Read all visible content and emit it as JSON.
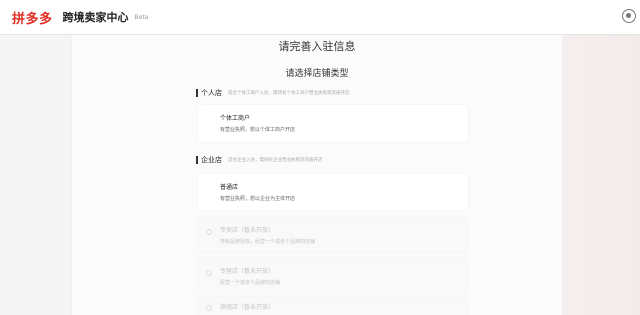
{
  "header": {
    "logo": "拼多多",
    "brand": "跨境卖家中心",
    "beta": "Beta",
    "user_icon": "user-icon"
  },
  "page": {
    "title": "请完善入驻信息",
    "subtitle": "请选择店铺类型"
  },
  "sections": [
    {
      "title": "个人店",
      "note": "适合个体工商户入驻，需持有个体工商户营业执照等资质开店",
      "options": [
        {
          "title": "个体工商户",
          "desc": "有营业执照，想以个体工商户开店",
          "disabled": false
        }
      ]
    },
    {
      "title": "企业店",
      "note": "适合企业入驻，需持有企业营业执照等资质开店",
      "options": [
        {
          "title": "普通店",
          "desc": "有营业执照，想以企业为主体开店",
          "disabled": false
        },
        {
          "title": "专卖店（暂未开放）",
          "desc": "持有品牌授权，经营一个或多个品牌的店铺",
          "disabled": true
        },
        {
          "title": "专营店（暂未开放）",
          "desc": "经营一个或多个品牌的店铺",
          "disabled": true
        },
        {
          "title": "旗舰店（暂未开放）",
          "desc": "",
          "disabled": true
        }
      ]
    }
  ],
  "colors": {
    "brand_red": "#e02e24",
    "disabled_text": "#c4c4c4"
  }
}
